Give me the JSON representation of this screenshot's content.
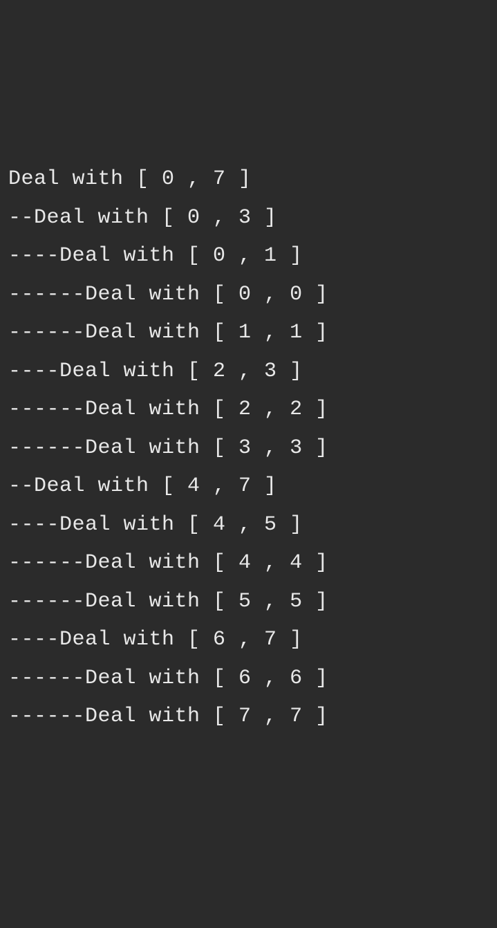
{
  "output": {
    "lines": [
      "Deal with [ 0 , 7 ]",
      "--Deal with [ 0 , 3 ]",
      "----Deal with [ 0 , 1 ]",
      "------Deal with [ 0 , 0 ]",
      "------Deal with [ 1 , 1 ]",
      "----Deal with [ 2 , 3 ]",
      "------Deal with [ 2 , 2 ]",
      "------Deal with [ 3 , 3 ]",
      "--Deal with [ 4 , 7 ]",
      "----Deal with [ 4 , 5 ]",
      "------Deal with [ 4 , 4 ]",
      "------Deal with [ 5 , 5 ]",
      "----Deal with [ 6 , 7 ]",
      "------Deal with [ 6 , 6 ]",
      "------Deal with [ 7 , 7 ]"
    ]
  }
}
